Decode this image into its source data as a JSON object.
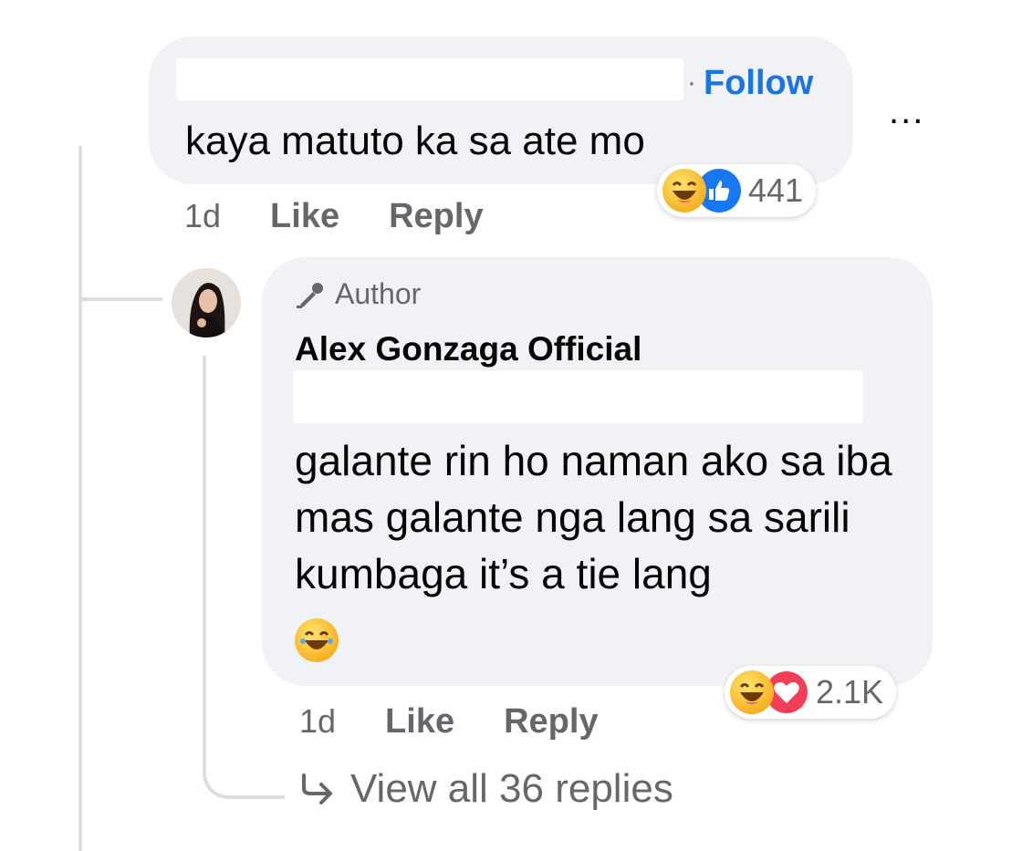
{
  "comment": {
    "follow_label": "Follow",
    "separator": "·",
    "text": "kaya matuto ka sa ate mo",
    "reactions": {
      "icons": [
        "haha-emoji",
        "like-icon"
      ],
      "count": "441"
    },
    "time": "1d",
    "like_label": "Like",
    "reply_label": "Reply",
    "more_label": "..."
  },
  "reply": {
    "badge": "Author",
    "name": "Alex Gonzaga Official",
    "text": "galante rin ho naman ako sa iba mas galante nga lang sa sarili kumbaga it’s a tie lang",
    "reactions": {
      "icons": [
        "haha-emoji",
        "love-icon"
      ],
      "count": "2.1K"
    },
    "time": "1d",
    "like_label": "Like",
    "reply_label": "Reply"
  },
  "view_replies_label": "View all 36 replies",
  "colors": {
    "bubble": "#f0f2f5",
    "follow": "#1b74e4",
    "muted": "#65676b",
    "like": "#1877f2",
    "love": "#f33e58"
  }
}
